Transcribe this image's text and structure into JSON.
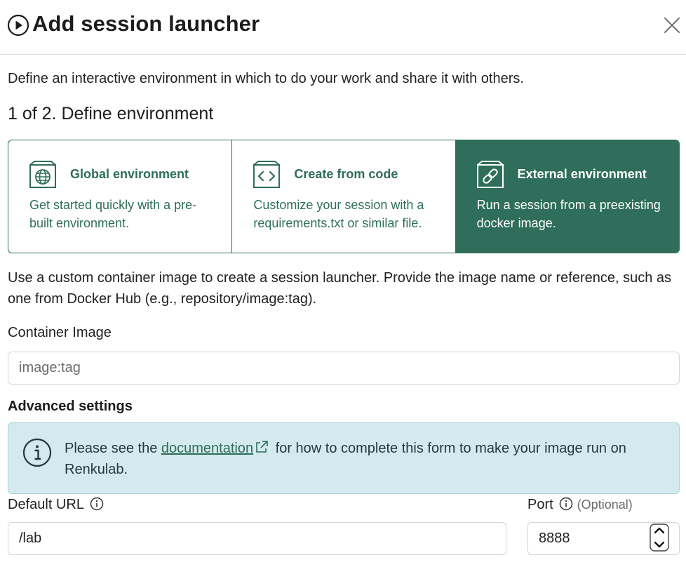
{
  "header": {
    "title": "Add session launcher",
    "play_icon": "play-circle-icon",
    "close_icon": "close-icon"
  },
  "intro": "Define an interactive environment in which to do your work and share it with others.",
  "step": "1 of 2. Define environment",
  "cards": [
    {
      "title": "Global environment",
      "description": "Get started quickly with a pre-built environment.",
      "icon": "globe-box-icon",
      "selected": false
    },
    {
      "title": "Create from code",
      "description": "Customize your session with a requirements.txt or similar file.",
      "icon": "code-box-icon",
      "selected": false
    },
    {
      "title": "External environment",
      "description": "Run a session from a preexisting docker image.",
      "icon": "link-box-icon",
      "selected": true
    }
  ],
  "description": "Use a custom container image to create a session launcher. Provide the image name or reference, such as one from Docker Hub (e.g., repository/image:tag).",
  "container_image": {
    "label": "Container Image",
    "placeholder": "image:tag",
    "value": ""
  },
  "advanced": {
    "title": "Advanced settings",
    "alert": {
      "prefix": "Please see the ",
      "link": "documentation",
      "suffix": " for how to complete this form to make your image run on Renkulab."
    }
  },
  "default_url": {
    "label": "Default URL",
    "value": "/lab"
  },
  "port": {
    "label": "Port",
    "optional": "(Optional)",
    "value": "8888"
  },
  "colors": {
    "accent": "#2e6e5a",
    "alert_bg": "#d4eaee"
  }
}
